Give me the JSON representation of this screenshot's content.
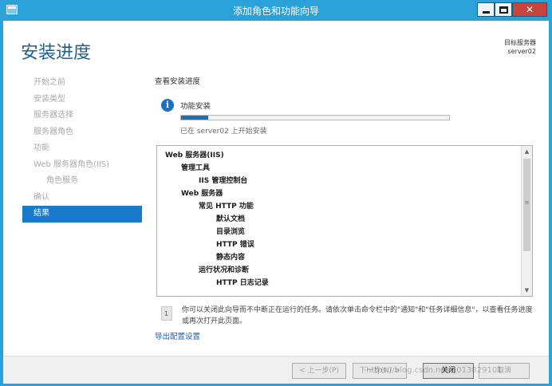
{
  "window": {
    "title": "添加角色和功能向导",
    "close_glyph": "✕"
  },
  "header": {
    "page_title": "安装进度",
    "target_server_label": "目标服务器",
    "target_server_name": "server02"
  },
  "nav": {
    "items": [
      {
        "label": "开始之前"
      },
      {
        "label": "安装类型"
      },
      {
        "label": "服务器选择"
      },
      {
        "label": "服务器角色"
      },
      {
        "label": "功能"
      },
      {
        "label": "Web 服务器角色(IIS)"
      },
      {
        "label": "角色服务"
      },
      {
        "label": "确认"
      },
      {
        "label": "结果"
      }
    ],
    "active": "结果"
  },
  "content": {
    "heading": "查看安装进度",
    "info_glyph": "i",
    "feature_label": "功能安装",
    "progress_fraction": 0.1,
    "status_text": "已在 server02 上开始安装",
    "results": [
      {
        "label": "Web 服务器(IIS)"
      },
      {
        "label": "管理工具"
      },
      {
        "label": "IIS 管理控制台"
      },
      {
        "label": "Web 服务器"
      },
      {
        "label": "常见 HTTP 功能"
      },
      {
        "label": "默认文档"
      },
      {
        "label": "目录浏览"
      },
      {
        "label": "HTTP 错误"
      },
      {
        "label": "静态内容"
      },
      {
        "label": "运行状况和诊断"
      },
      {
        "label": "HTTP 日志记录"
      }
    ],
    "scroll_up_glyph": "▲",
    "scroll_down_glyph": "▼",
    "scroll_grip_glyph": "≡",
    "note_text": "你可以关闭此向导而不中断正在运行的任务。请依次单击命令栏中的\"通知\"和\"任务详细信息\"，以查看任务进度或再次打开此页面。",
    "export_link": "导出配置设置"
  },
  "footer": {
    "prev_label": "< 上一步(P)",
    "next_label": "下一步(N) >",
    "close_label": "关闭",
    "cancel_label": "取消",
    "watermark": "https://blog.csdn.net/u013829101"
  },
  "colors": {
    "titlebar": "#2aa2d9",
    "active_nav": "#1979ca",
    "page_title": "#1d5f91",
    "link": "#1a63b5",
    "progress": "#1d6fb8"
  }
}
